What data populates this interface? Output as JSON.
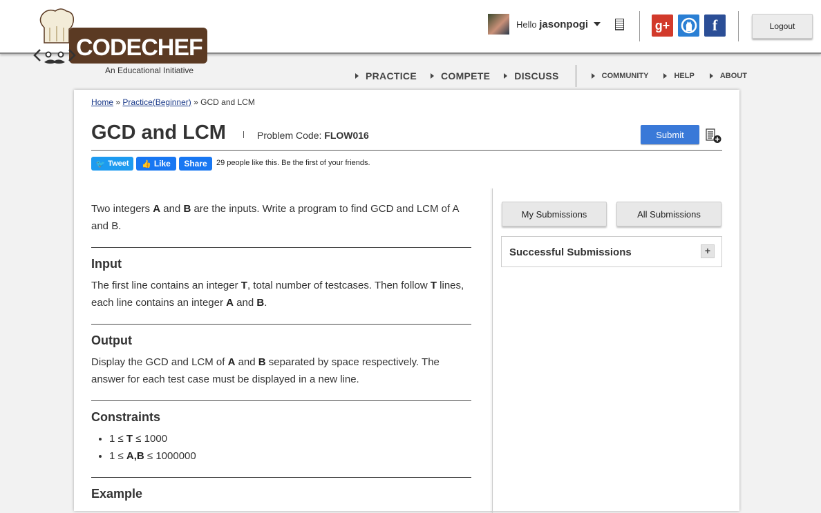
{
  "logo": {
    "text": "CODECHEF",
    "subtitle": "An Educational Initiative"
  },
  "user": {
    "greeting": "Hello",
    "username": "jasonpogi"
  },
  "header": {
    "logout_label": "Logout"
  },
  "social": {
    "gplus": "g+",
    "facebook": "f"
  },
  "nav": {
    "primary": [
      "PRACTICE",
      "COMPETE",
      "DISCUSS"
    ],
    "secondary": [
      "COMMUNITY",
      "HELP",
      "ABOUT"
    ]
  },
  "breadcrumb": {
    "home": "Home",
    "sep": "»",
    "practice": "Practice(Beginner)",
    "current": "GCD and LCM"
  },
  "problem": {
    "title": "GCD and LCM",
    "code_label": "Problem Code:",
    "code": "FLOW016",
    "submit_label": "Submit"
  },
  "share": {
    "tweet": "Tweet",
    "like": "Like",
    "share": "Share",
    "likes_text": "29 people like this. Be the first of your friends."
  },
  "statement": {
    "intro": [
      "Two integers ",
      "A",
      " and ",
      "B",
      " are the inputs. Write a program to find GCD and LCM of A and B."
    ],
    "input_heading": "Input",
    "input_text": [
      "The first line contains an integer ",
      "T",
      ", total number of testcases. Then follow ",
      "T",
      " lines, each line contains an integer ",
      "A",
      " and ",
      "B",
      "."
    ],
    "output_heading": "Output",
    "output_text": [
      "Display the GCD and LCM of ",
      "A",
      " and ",
      "B",
      " separated by space respectively. The answer for each test case must be displayed in a new line."
    ],
    "constraints_heading": "Constraints",
    "constraints": [
      [
        "1 ≤ ",
        "T",
        " ≤ 1000"
      ],
      [
        "1 ≤ ",
        "A,B",
        " ≤ 1000000"
      ]
    ],
    "example_heading": "Example"
  },
  "sidebar": {
    "my_submissions": "My Submissions",
    "all_submissions": "All Submissions",
    "successful_submissions": "Successful Submissions",
    "expand": "+"
  },
  "colors": {
    "submit": "#3a79d8",
    "tweet": "#1d9bf0",
    "facebook": "#1877f2",
    "gplus": "#d23a2b",
    "github": "#2a7fd4",
    "brand": "#5b3a23"
  }
}
